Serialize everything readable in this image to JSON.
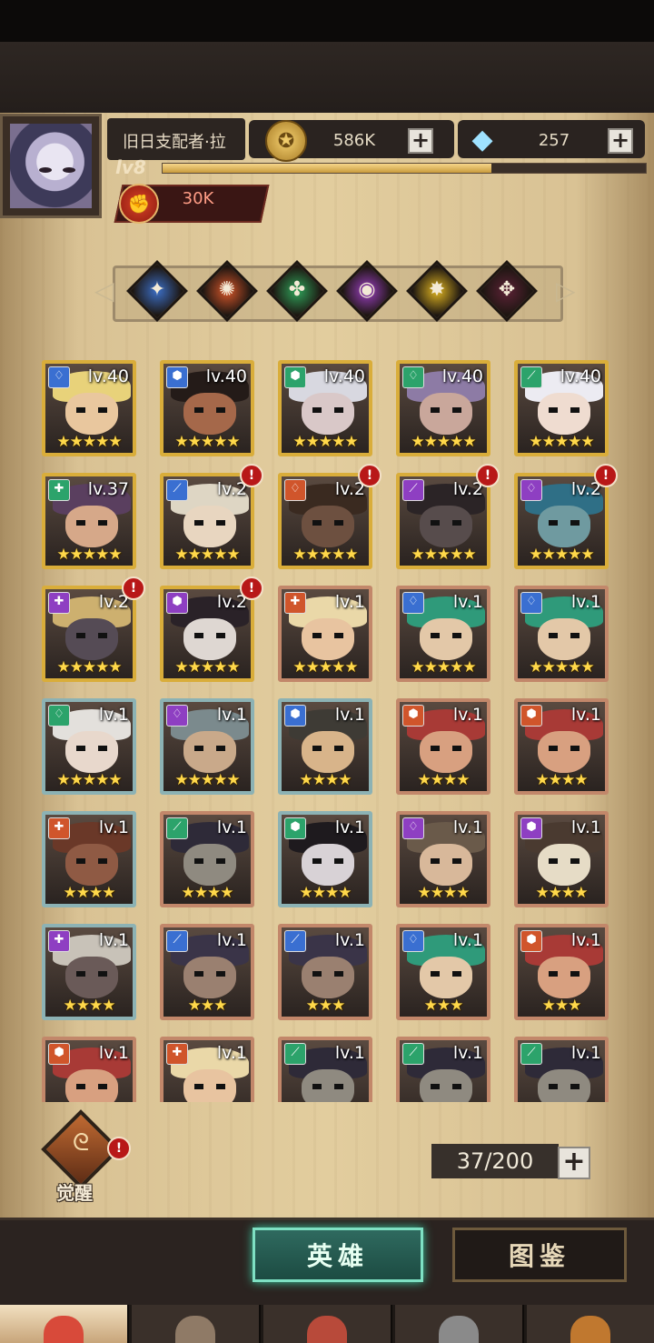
{
  "player": {
    "name": "旧日支配者·拉",
    "level": "lv8",
    "xp_fraction": 0.68,
    "power": "30K"
  },
  "resources": {
    "gold": "586K",
    "diamonds": "257",
    "gold_icon": "coin-icon",
    "diamond_icon": "diamond-icon"
  },
  "factions": [
    {
      "name": "faction-light",
      "glyph": "✦",
      "color": "#3b6fc7"
    },
    {
      "name": "faction-fire",
      "glyph": "✺",
      "color": "#d6562a"
    },
    {
      "name": "faction-nature",
      "glyph": "✤",
      "color": "#2fa35a"
    },
    {
      "name": "faction-arcane",
      "glyph": "◉",
      "color": "#9b3fc2"
    },
    {
      "name": "faction-holy",
      "glyph": "✸",
      "color": "#e0b521"
    },
    {
      "name": "faction-dark",
      "glyph": "✥",
      "color": "#5c2236"
    }
  ],
  "heroes": [
    {
      "level": "lv.40",
      "stars": "★★★★★",
      "rarity": "gold",
      "class_color": "#3a6fd1",
      "class_glyph": "♢",
      "alert": false,
      "hair": "#e8d27a",
      "skin": "#e9c79e"
    },
    {
      "level": "lv.40",
      "stars": "★★★★★",
      "rarity": "gold",
      "class_color": "#3a6fd1",
      "class_glyph": "⬢",
      "alert": false,
      "hair": "#241b18",
      "skin": "#a5684a"
    },
    {
      "level": "lv.40",
      "stars": "★★★★★",
      "rarity": "gold",
      "class_color": "#2ca36b",
      "class_glyph": "⬢",
      "alert": false,
      "hair": "#d8d8e0",
      "skin": "#d9c8c8"
    },
    {
      "level": "lv.40",
      "stars": "★★★★★",
      "rarity": "gold",
      "class_color": "#2ca36b",
      "class_glyph": "♢",
      "alert": false,
      "hair": "#8d7ba5",
      "skin": "#c9a79b"
    },
    {
      "level": "lv.40",
      "stars": "★★★★★",
      "rarity": "gold",
      "class_color": "#2ca36b",
      "class_glyph": "⟋",
      "alert": false,
      "hair": "#ecebf2",
      "skin": "#efdcd0"
    },
    {
      "level": "lv.37",
      "stars": "★★★★★",
      "rarity": "gold",
      "class_color": "#2ca36b",
      "class_glyph": "✚",
      "alert": false,
      "hair": "#5a3f5f",
      "skin": "#d6a889"
    },
    {
      "level": "lv.2",
      "stars": "★★★★★",
      "rarity": "gold",
      "class_color": "#3a6fd1",
      "class_glyph": "⟋",
      "alert": true,
      "hair": "#ded6c4",
      "skin": "#e8d6c0"
    },
    {
      "level": "lv.2",
      "stars": "★★★★★",
      "rarity": "gold",
      "class_color": "#d0552b",
      "class_glyph": "♢",
      "alert": true,
      "hair": "#3a2a20",
      "skin": "#6d5040"
    },
    {
      "level": "lv.2",
      "stars": "★★★★★",
      "rarity": "gold",
      "class_color": "#8e3fc2",
      "class_glyph": "⟋",
      "alert": true,
      "hair": "#2b2426",
      "skin": "#574c4c"
    },
    {
      "level": "lv.2",
      "stars": "★★★★★",
      "rarity": "gold",
      "class_color": "#8e3fc2",
      "class_glyph": "♢",
      "alert": true,
      "hair": "#2f6f86",
      "skin": "#6f9aa0"
    },
    {
      "level": "lv.2",
      "stars": "★★★★★",
      "rarity": "gold",
      "class_color": "#8e3fc2",
      "class_glyph": "✚",
      "alert": true,
      "hair": "#cdb06f",
      "skin": "#554b55"
    },
    {
      "level": "lv.2",
      "stars": "★★★★★",
      "rarity": "gold",
      "class_color": "#8e3fc2",
      "class_glyph": "⬢",
      "alert": true,
      "hair": "#2a2228",
      "skin": "#ded7d2"
    },
    {
      "level": "lv.1",
      "stars": "★★★★★",
      "rarity": "bronze",
      "class_color": "#d0552b",
      "class_glyph": "✚",
      "alert": false,
      "hair": "#ead8a8",
      "skin": "#e8c4a0"
    },
    {
      "level": "lv.1",
      "stars": "★★★★★",
      "rarity": "bronze",
      "class_color": "#3a6fd1",
      "class_glyph": "♢",
      "alert": false,
      "hair": "#2f9a7a",
      "skin": "#e3c8a8"
    },
    {
      "level": "lv.1",
      "stars": "★★★★★",
      "rarity": "bronze",
      "class_color": "#3a6fd1",
      "class_glyph": "♢",
      "alert": false,
      "hair": "#2f9a7a",
      "skin": "#e3c8a8"
    },
    {
      "level": "lv.1",
      "stars": "★★★★★",
      "rarity": "teal",
      "class_color": "#2ca36b",
      "class_glyph": "♢",
      "alert": false,
      "hair": "#e3e0dc",
      "skin": "#e8d8cc"
    },
    {
      "level": "lv.1",
      "stars": "★★★★★",
      "rarity": "teal",
      "class_color": "#8e3fc2",
      "class_glyph": "♢",
      "alert": false,
      "hair": "#7b8a8d",
      "skin": "#c9a98a"
    },
    {
      "level": "lv.1",
      "stars": "★★★★",
      "rarity": "teal",
      "class_color": "#3a6fd1",
      "class_glyph": "⬢",
      "alert": false,
      "hair": "#3e3b35",
      "skin": "#d8b48a"
    },
    {
      "level": "lv.1",
      "stars": "★★★★",
      "rarity": "bronze",
      "class_color": "#d0552b",
      "class_glyph": "⬢",
      "alert": false,
      "hair": "#a83a36",
      "skin": "#d8a080"
    },
    {
      "level": "lv.1",
      "stars": "★★★★",
      "rarity": "bronze",
      "class_color": "#d0552b",
      "class_glyph": "⬢",
      "alert": false,
      "hair": "#a83a36",
      "skin": "#d8a080"
    },
    {
      "level": "lv.1",
      "stars": "★★★★",
      "rarity": "teal",
      "class_color": "#d0552b",
      "class_glyph": "✚",
      "alert": false,
      "hair": "#6a3828",
      "skin": "#8f5a44"
    },
    {
      "level": "lv.1",
      "stars": "★★★★",
      "rarity": "bronze",
      "class_color": "#2ca36b",
      "class_glyph": "⟋",
      "alert": false,
      "hair": "#2e2a38",
      "skin": "#8f8a80"
    },
    {
      "level": "lv.1",
      "stars": "★★★★",
      "rarity": "teal",
      "class_color": "#2ca36b",
      "class_glyph": "⬢",
      "alert": false,
      "hair": "#1e1a1e",
      "skin": "#d8d2d6"
    },
    {
      "level": "lv.1",
      "stars": "★★★★",
      "rarity": "bronze",
      "class_color": "#8e3fc2",
      "class_glyph": "♢",
      "alert": false,
      "hair": "#6a5a4a",
      "skin": "#d8b89a"
    },
    {
      "level": "lv.1",
      "stars": "★★★★",
      "rarity": "bronze",
      "class_color": "#8e3fc2",
      "class_glyph": "⬢",
      "alert": false,
      "hair": "#4a3a30",
      "skin": "#e6dcc6"
    },
    {
      "level": "lv.1",
      "stars": "★★★★",
      "rarity": "teal",
      "class_color": "#8e3fc2",
      "class_glyph": "✚",
      "alert": false,
      "hair": "#c8c2b8",
      "skin": "#6a5a58"
    },
    {
      "level": "lv.1",
      "stars": "★★★",
      "rarity": "bronze",
      "class_color": "#3a6fd1",
      "class_glyph": "⟋",
      "alert": false,
      "hair": "#3a3448",
      "skin": "#9a8070"
    },
    {
      "level": "lv.1",
      "stars": "★★★",
      "rarity": "bronze",
      "class_color": "#3a6fd1",
      "class_glyph": "⟋",
      "alert": false,
      "hair": "#3a3448",
      "skin": "#9a8070"
    },
    {
      "level": "lv.1",
      "stars": "★★★",
      "rarity": "bronze",
      "class_color": "#3a6fd1",
      "class_glyph": "♢",
      "alert": false,
      "hair": "#2f9a7a",
      "skin": "#e3c8a8"
    },
    {
      "level": "lv.1",
      "stars": "★★★",
      "rarity": "bronze",
      "class_color": "#d0552b",
      "class_glyph": "⬢",
      "alert": false,
      "hair": "#a83a36",
      "skin": "#d8a080"
    },
    {
      "level": "lv.1",
      "stars": "",
      "rarity": "bronze",
      "class_color": "#d0552b",
      "class_glyph": "⬢",
      "alert": false,
      "hair": "#a83a36",
      "skin": "#d8a080"
    },
    {
      "level": "lv.1",
      "stars": "",
      "rarity": "bronze",
      "class_color": "#d0552b",
      "class_glyph": "✚",
      "alert": false,
      "hair": "#ead8a8",
      "skin": "#e8c4a0"
    },
    {
      "level": "lv.1",
      "stars": "",
      "rarity": "bronze",
      "class_color": "#2ca36b",
      "class_glyph": "⟋",
      "alert": false,
      "hair": "#2e2a38",
      "skin": "#8f8a80"
    },
    {
      "level": "lv.1",
      "stars": "",
      "rarity": "bronze",
      "class_color": "#2ca36b",
      "class_glyph": "⟋",
      "alert": false,
      "hair": "#2e2a38",
      "skin": "#8f8a80"
    },
    {
      "level": "lv.1",
      "stars": "",
      "rarity": "bronze",
      "class_color": "#2ca36b",
      "class_glyph": "⟋",
      "alert": false,
      "hair": "#2e2a38",
      "skin": "#8f8a80"
    }
  ],
  "awaken": {
    "label": "觉醒",
    "icon": "awaken-icon",
    "alert": "!"
  },
  "capacity": {
    "text": "37/200"
  },
  "tabs": {
    "heroes": "英雄",
    "codex": "图鉴"
  },
  "nav": [
    {
      "name": "nav-heroes",
      "icon": "hero-portrait-icon",
      "active": true
    },
    {
      "name": "nav-guild",
      "icon": "guild-icon",
      "active": false
    },
    {
      "name": "nav-battle",
      "icon": "battle-icon",
      "active": false
    },
    {
      "name": "nav-castle",
      "icon": "castle-icon",
      "active": false
    },
    {
      "name": "nav-shop",
      "icon": "shop-icon",
      "active": false
    }
  ],
  "colors": {
    "gold_frame": "#d9ad3a",
    "teal_frame": "#8cb2b4",
    "bronze_frame": "#c2876a",
    "accent_green": "#7ee0c3"
  }
}
